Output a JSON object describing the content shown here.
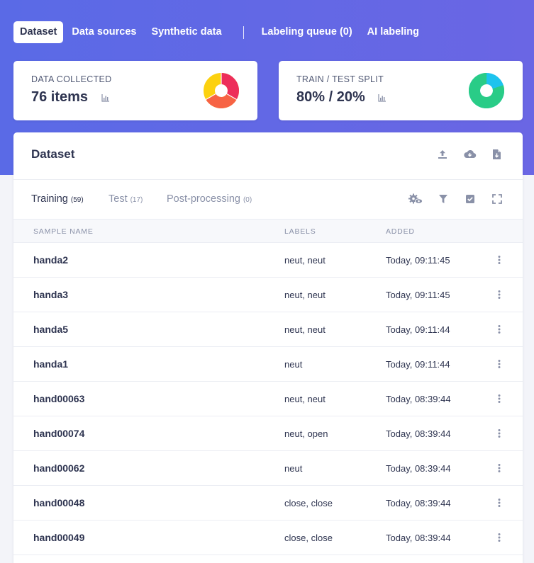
{
  "nav": {
    "items": [
      {
        "label": "Dataset",
        "active": true
      },
      {
        "label": "Data sources",
        "active": false
      },
      {
        "label": "Synthetic data",
        "active": false
      },
      {
        "label": "Labeling queue (0)",
        "active": false
      },
      {
        "label": "AI labeling",
        "active": false
      }
    ]
  },
  "stats": {
    "collected": {
      "label": "DATA COLLECTED",
      "value": "76 items",
      "icon": "bar-chart-icon",
      "donut_colors": [
        "#ed2e5a",
        "#f76344",
        "#fcd10f"
      ]
    },
    "split": {
      "label": "TRAIN / TEST SPLIT",
      "value": "80% / 20%",
      "icon": "bar-chart-icon",
      "train_share": 0.8,
      "donut_colors": {
        "train": "#29cc87",
        "test": "#1dc3ee"
      }
    }
  },
  "panel": {
    "title": "Dataset",
    "actions": [
      "upload-icon",
      "cloud-download-icon",
      "file-export-icon"
    ]
  },
  "tabs": [
    {
      "label": "Training",
      "count": "(59)",
      "active": true
    },
    {
      "label": "Test",
      "count": "(17)",
      "active": false
    },
    {
      "label": "Post-processing",
      "count": "(0)",
      "active": false
    }
  ],
  "toolbar": [
    "gear-eye-icon",
    "filter-icon",
    "checkbox-icon",
    "fullscreen-icon"
  ],
  "table": {
    "headers": {
      "name": "SAMPLE NAME",
      "labels": "LABELS",
      "added": "ADDED"
    },
    "rows": [
      {
        "name": "handa2",
        "labels": "neut, neut",
        "added": "Today, 09:11:45"
      },
      {
        "name": "handa3",
        "labels": "neut, neut",
        "added": "Today, 09:11:45"
      },
      {
        "name": "handa5",
        "labels": "neut, neut",
        "added": "Today, 09:11:44"
      },
      {
        "name": "handa1",
        "labels": "neut",
        "added": "Today, 09:11:44"
      },
      {
        "name": "hand00063",
        "labels": "neut, neut",
        "added": "Today, 08:39:44"
      },
      {
        "name": "hand00074",
        "labels": "neut, open",
        "added": "Today, 08:39:44"
      },
      {
        "name": "hand00062",
        "labels": "neut",
        "added": "Today, 08:39:44"
      },
      {
        "name": "hand00048",
        "labels": "close, close",
        "added": "Today, 08:39:44"
      },
      {
        "name": "hand00049",
        "labels": "close, close",
        "added": "Today, 08:39:44"
      }
    ]
  },
  "colors": {
    "hero": "#5a6ae6",
    "text": "#2e3450",
    "muted": "#8a91a8"
  }
}
